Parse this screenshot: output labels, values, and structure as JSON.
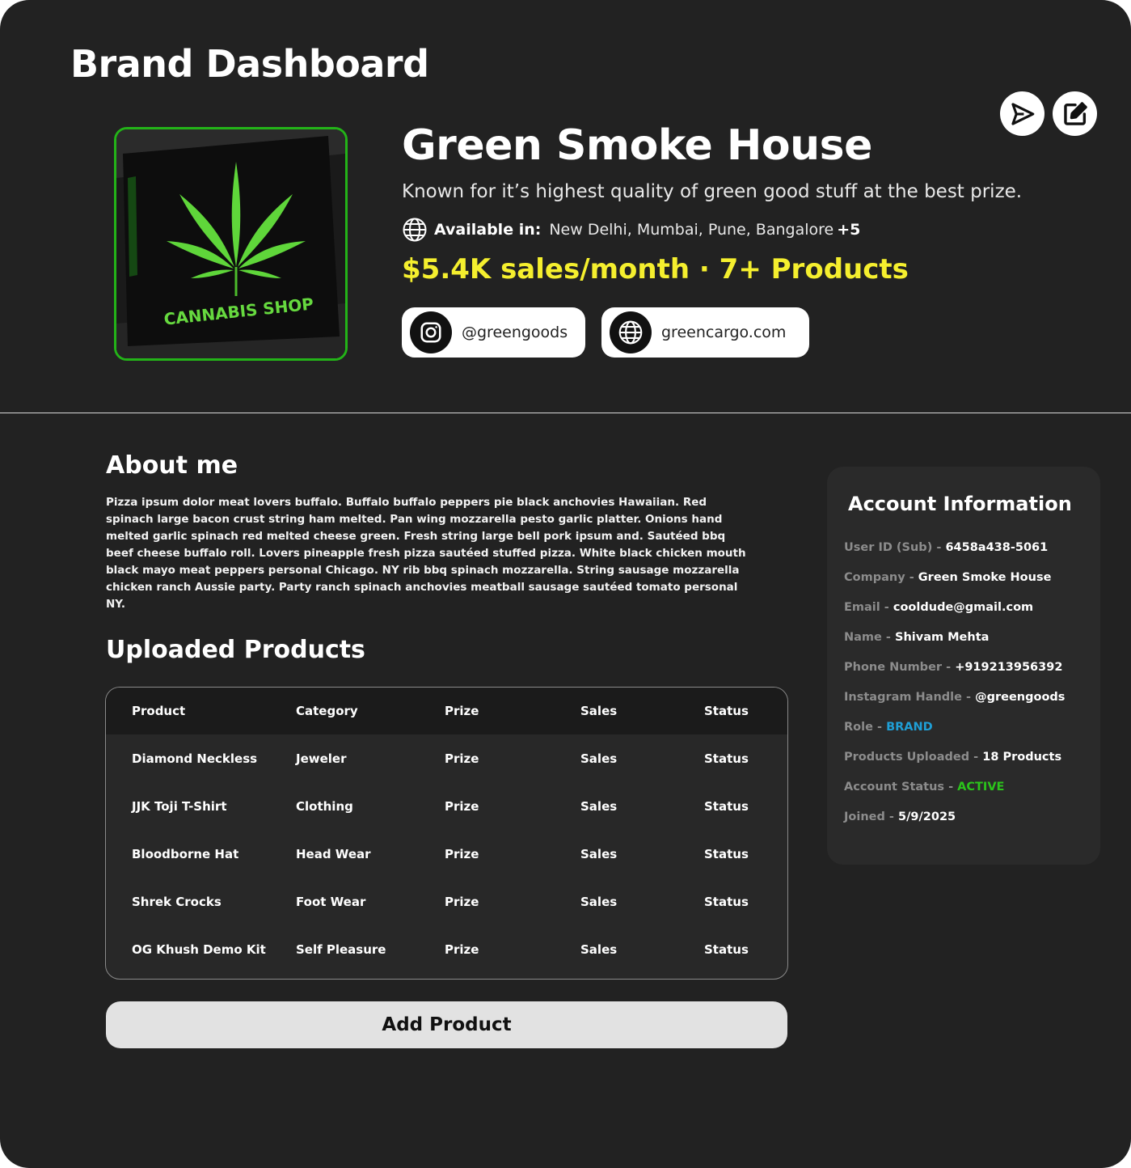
{
  "page_title": "Brand Dashboard",
  "actions": {
    "send_icon": "send-icon",
    "edit_icon": "edit-icon"
  },
  "brand": {
    "name": "Green Smoke House",
    "tagline": "Known for it’s highest quality of green good stuff at the best prize.",
    "available_label": "Available in:",
    "available_cities": "New Delhi, Mumbai, Pune, Bangalore",
    "available_more": "+5",
    "stats": "$5.4K sales/month · 7+ Products",
    "image_sign_text": "CANNABIS SHOP",
    "accent_color": "#23b318",
    "stats_color": "#f5ef2e"
  },
  "links": [
    {
      "icon": "instagram-icon",
      "text": "@greengoods"
    },
    {
      "icon": "globe-icon",
      "text": "greencargo.com"
    }
  ],
  "about": {
    "title": "About me",
    "text": "Pizza ipsum dolor meat lovers buffalo. Buffalo buffalo peppers pie black anchovies Hawaiian. Red spinach large bacon crust string ham melted. Pan wing mozzarella pesto garlic platter. Onions hand melted garlic spinach red melted cheese green. Fresh string large bell pork ipsum and. Sautéed bbq beef cheese buffalo roll. Lovers pineapple fresh pizza sautéed stuffed pizza. White black chicken mouth black mayo meat peppers personal Chicago. NY rib bbq spinach mozzarella. String sausage mozzarella chicken ranch Aussie party. Party ranch spinach anchovies meatball sausage sautéed tomato personal NY."
  },
  "products": {
    "title": "Uploaded Products",
    "columns": [
      "Product",
      "Category",
      "Prize",
      "Sales",
      "Status"
    ],
    "rows": [
      [
        "Diamond Neckless",
        "Jeweler",
        "Prize",
        "Sales",
        "Status"
      ],
      [
        "JJK Toji T-Shirt",
        "Clothing",
        "Prize",
        "Sales",
        "Status"
      ],
      [
        "Bloodborne Hat",
        "Head Wear",
        "Prize",
        "Sales",
        "Status"
      ],
      [
        "Shrek Crocks",
        "Foot Wear",
        "Prize",
        "Sales",
        "Status"
      ],
      [
        "OG Khush Demo Kit",
        "Self Pleasure",
        "Prize",
        "Sales",
        "Status"
      ]
    ],
    "add_button": "Add Product"
  },
  "account": {
    "title": "Account Information",
    "fields": [
      {
        "label": "User ID (Sub)",
        "value": "6458a438-5061",
        "color": "#ffffff"
      },
      {
        "label": "Company",
        "value": "Green Smoke House",
        "color": "#ffffff"
      },
      {
        "label": "Email",
        "value": "cooldude@gmail.com",
        "color": "#ffffff"
      },
      {
        "label": "Name",
        "value": "Shivam Mehta",
        "color": "#ffffff"
      },
      {
        "label": "Phone Number",
        "value": "+919213956392",
        "color": "#ffffff"
      },
      {
        "label": "Instagram Handle",
        "value": "@greengoods",
        "color": "#ffffff"
      },
      {
        "label": "Role",
        "value": "BRAND",
        "color": "#1f9fd6"
      },
      {
        "label": "Products Uploaded",
        "value": "18 Products",
        "color": "#ffffff"
      },
      {
        "label": "Account Status",
        "value": "ACTIVE",
        "color": "#2bc41b"
      },
      {
        "label": "Joined",
        "value": "5/9/2025",
        "color": "#ffffff"
      }
    ]
  }
}
